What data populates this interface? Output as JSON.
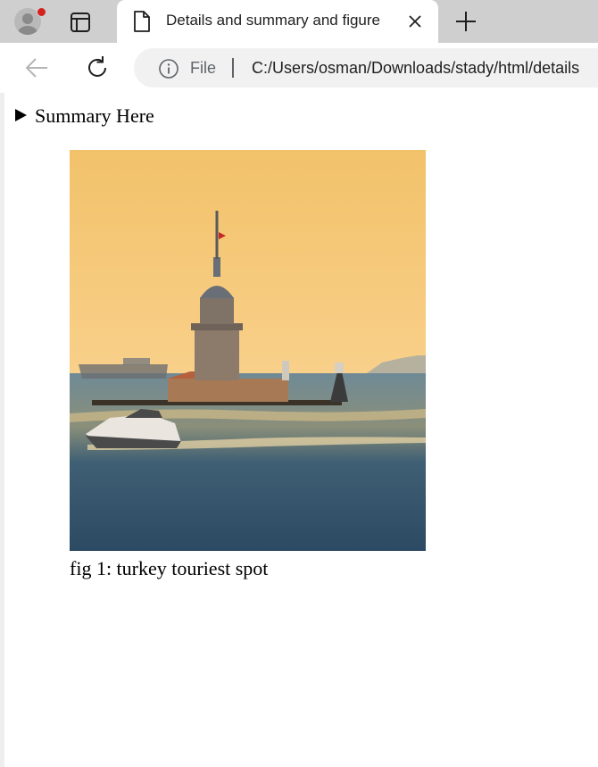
{
  "browser": {
    "tab": {
      "title": "Details and summary and figure"
    },
    "address": {
      "scheme_label": "File",
      "url": "C:/Users/osman/Downloads/stady/html/details"
    },
    "colors": {
      "notification_dot": "#d4211f"
    }
  },
  "page": {
    "summary_text": "Summary Here",
    "figure": {
      "caption": "fig 1: turkey touriest spot"
    }
  }
}
